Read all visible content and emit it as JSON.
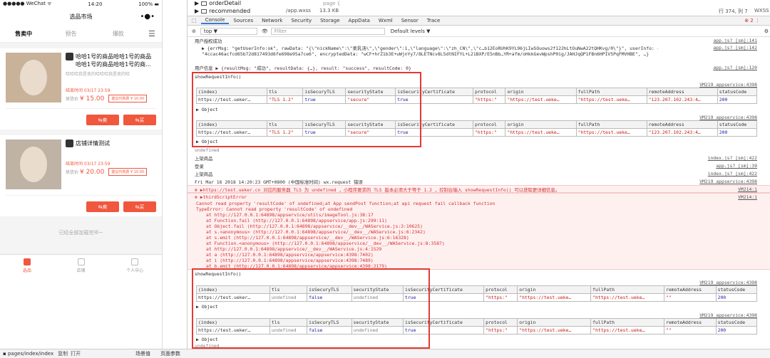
{
  "phone": {
    "carrier": "●●●●● WeChat ᯤ",
    "time": "14:20",
    "battery": "100% ▬",
    "nav_title": "选品市场",
    "tabs": [
      "售卖中",
      "预告",
      "爆款"
    ],
    "items": [
      {
        "title": "哈哈1号的商品哈哈1号的商品哈哈1号的商品哈哈1号的商...",
        "desc": "哈哈哈我是卖的哈哈哈我是卖的哈",
        "end": "结束时间 03/17 23:59",
        "price_label": "供货价",
        "price": "¥ 15.00",
        "bid": "建议代购费 ¥ 10.00",
        "sell": "卖",
        "buy": "买"
      },
      {
        "title": "店铺详情测试",
        "desc": "",
        "end": "结束时间 03/17 23:59",
        "price_label": "供货价",
        "price": "¥ 20.00",
        "bid": "建议代购费 ¥ 10.00",
        "sell": "卖",
        "buy": "买"
      }
    ],
    "loaded": "已经全部加载完毕~",
    "tabbar": [
      "选品",
      "店铺",
      "个人中心"
    ]
  },
  "tree": {
    "a": "orderDetail",
    "b": "recommended"
  },
  "src": {
    "file": "/app.wxss",
    "size": "13.3 KB",
    "line": "page {",
    "pos": "行 374, 列 7",
    "tag": "WXSS"
  },
  "tabs": [
    "Console",
    "Sources",
    "Network",
    "Security",
    "Storage",
    "AppData",
    "Wxml",
    "Sensor",
    "Trace"
  ],
  "badge": "2",
  "filter": {
    "ctx": "top",
    "ph": "Filter",
    "level": "Default levels ▼"
  },
  "logs": {
    "l1": "用户授权成功",
    "l1s": "app.js? [sm]:141",
    "l2": "▶ {errMsg: \"getUserInfo:ok\", rawData: \"{\\\"nickName\\\":\\\"柔乳汤\\\",\\\"gender\\\":1,\\\"language\\\":\\\"zh_CN\\\",\\\"c…b12EoRUhK9YL96jLIwSOuows2f122hLtOuNwA22tQHKvg/0\\\"}\", userInfo: {…}, signature:",
    "l2s": "app.js? [sm]:142",
    "l3": "\"4ccac46acfcd65b72d817493d6fe698e95a7ce6\", encryptedData: \"wCF+hrZ1b3E+uWjnYy7/8LETNcv8L5dtNIFYL+L21BXP/E5nBb…YR+afm/oHkkGevWpshP0ig/JAHJqQP1FBn6HPIV5PqFMVHBE\", …}",
    "l4": "用户信息 ▶ {resultMsg: \"成功\", resultData: {…}, result: \"success\", resultCode: 0}",
    "l4s": "app.js? [sm]:120",
    "show": "showRequestInfo()",
    "vm": "VM219 appservice:4398",
    "obj": "▶ Object",
    "undef": "undefined",
    "m1": "上架商品",
    "m1s": "index.js? [sm]:422",
    "m2": "登录",
    "m2s": "app.js? [sm]:39",
    "m3": "上架商品",
    "m3s": "index.js? [sm]:422",
    "req": "Fri Mar 16 2018 14:20:23 GMT+0800 (中国标准时间) wx.request 错误",
    "reqs": "VM219 appservice:4398",
    "e1": "▶https://test.ueker.cn 对应的服务器 TLS 为 undefined ，小程序要求的 TLS 版本必须大于等于 1.2 ，控制台输入 showRequestInfo() 可以获取更详细信息。",
    "e1s": "VM214:1",
    "e2": "▶thirdScriptError",
    "e2s": "VM214:1",
    "e3": "Cannot read property 'resultCode' of undefined;at App sendPost function;at api request fail callback function",
    "e4": "TypeError: Cannot read property 'resultCode' of undefined",
    "stack": [
      "at http://127.0.0.1:64898/appservice/utils/imageTool.js:38:17",
      "at Function.fail (http://127.0.0.1:64898/appservice/app.js:299:11)",
      "at Object.fail (http://127.0.0.1:64898/appservice/__dev__/WAService.js:3:10625)",
      "at s.<anonymous> (http://127.0.0.1:64898/appservice/__dev__/WAService.js:6:2342)",
      "at s.emit (http://127.0.0.1:64898/appservice/__dev__/WAService.js:6:16328)",
      "at Function.<anonymous> (http://127.0.0.1:64898/appservice/__dev__/WAService.js:8:3587)",
      "at http://127.0.0.1:64898/appservice/__dev__/WAService.js:4:1529",
      "at a (http://127.0.0.1:64898/appservice/appservice:4398:7402)",
      "at i (http://127.0.0.1:64898/appservice/appservice:4398:7489)",
      "at b.emit (http://127.0.0.1:64898/appservice/appservice:4398:2179)"
    ]
  },
  "table": {
    "headers": [
      "(index)",
      "tls",
      "isSecuryTLS",
      "securityState",
      "isSecurityCertificate",
      "protocol",
      "origin",
      "fullPath",
      "remoteAddress",
      "statusCode"
    ],
    "rowA": [
      "https://test.ueker…",
      "\"TLS 1.2\"",
      "true",
      "\"secure\"",
      "true",
      "\"https:\"",
      "\"https://test.ueke…",
      "\"https://test.ueke…",
      "\"123.207.102.243:4…",
      "200"
    ],
    "rowB": [
      "https://test.ueker…",
      "undefined",
      "false",
      "undefined",
      "true",
      "\"https:\"",
      "\"https://test.ueke…",
      "\"https://test.ueke…",
      "\"\"",
      "200"
    ]
  },
  "bottom": {
    "path": "pages/index/index",
    "copy": "复制",
    "open": "打开",
    "a": "场景值",
    "b": "页面参数"
  }
}
